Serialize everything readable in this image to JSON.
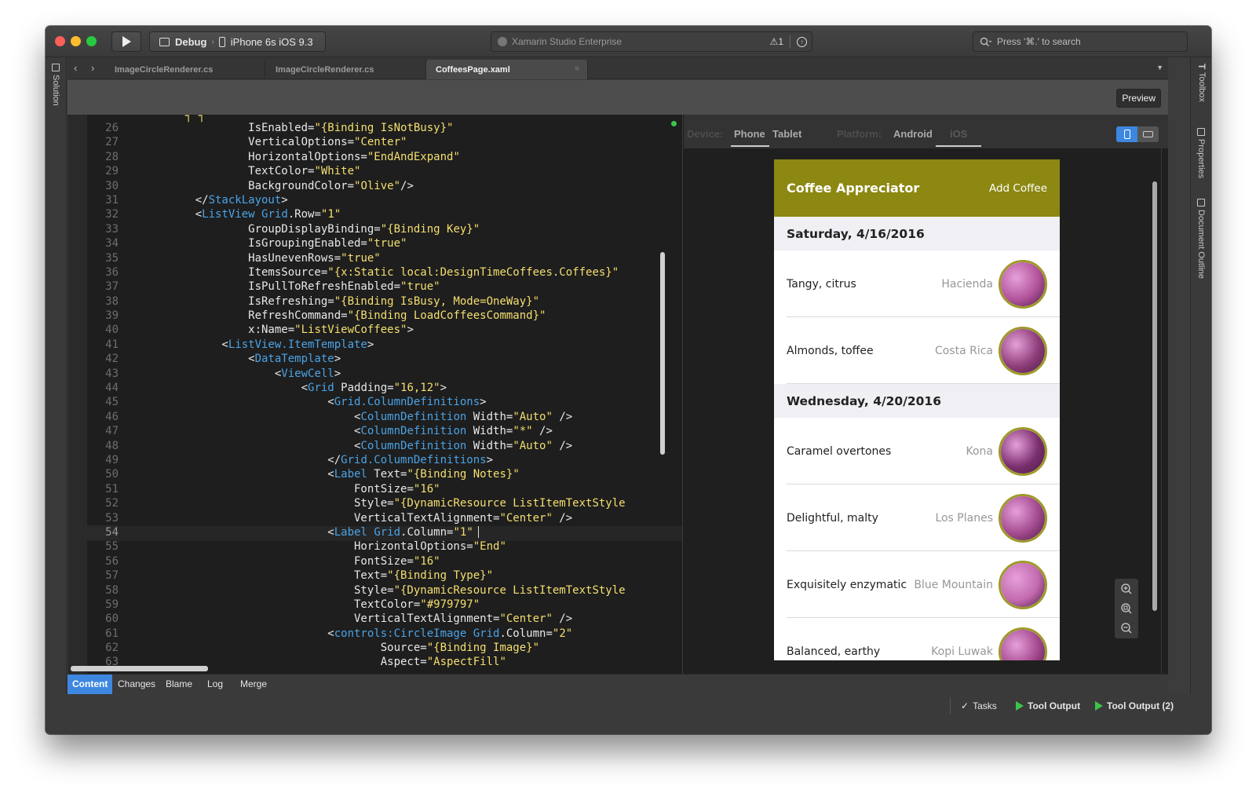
{
  "titlebar": {
    "config_label": "Debug",
    "device_label": "iPhone 6s iOS 9.3",
    "status_text": "Xamarin Studio Enterprise",
    "warning_count": "1",
    "search_placeholder": "Press '⌘.' to search"
  },
  "left_pad": {
    "solution_label": "Solution"
  },
  "right_pad": {
    "toolbox_label": "Toolbox",
    "properties_label": "Properties",
    "outline_label": "Document Outline"
  },
  "tabs": [
    {
      "label": "ImageCircleRenderer.cs"
    },
    {
      "label": "ImageCircleRenderer.cs"
    },
    {
      "label": "CoffeesPage.xaml"
    }
  ],
  "toolbar": {
    "preview_label": "Preview"
  },
  "editor": {
    "line_numbers": [
      "26",
      "27",
      "28",
      "29",
      "30",
      "31",
      "32",
      "33",
      "34",
      "35",
      "36",
      "37",
      "38",
      "39",
      "40",
      "41",
      "42",
      "43",
      "44",
      "45",
      "46",
      "47",
      "48",
      "49",
      "50",
      "51",
      "52",
      "53",
      "54",
      "55",
      "56",
      "57",
      "58",
      "59",
      "60",
      "61",
      "62",
      "63"
    ],
    "current_line": "54"
  },
  "preview": {
    "device_label": "Device:",
    "device_options": [
      "Phone",
      "Tablet"
    ],
    "platform_label": "Platform:",
    "platform_options": [
      "Android",
      "iOS"
    ],
    "app": {
      "title": "Coffee Appreciator",
      "action": "Add Coffee",
      "nav_color": "#8c8812",
      "thumb_border": "#9d9a2a",
      "groups": [
        {
          "date": "Saturday, 4/16/2016",
          "items": [
            {
              "notes": "Tangy, citrus",
              "type": "Hacienda",
              "tint": "#b2539b"
            },
            {
              "notes": "Almonds, toffee",
              "type": "Costa Rica",
              "tint": "#8e3d7a"
            }
          ]
        },
        {
          "date": "Wednesday, 4/20/2016",
          "items": [
            {
              "notes": "Caramel overtones",
              "type": "Kona",
              "tint": "#7a2f6e"
            },
            {
              "notes": "Delightful, malty",
              "type": "Los Planes",
              "tint": "#a24a8e"
            },
            {
              "notes": "Exquisitely enzymatic",
              "type": "Blue Mountain",
              "tint": "#c26aae"
            },
            {
              "notes": "Balanced, earthy",
              "type": "Kopi Luwak",
              "tint": "#a3488f"
            }
          ]
        }
      ]
    }
  },
  "bottom_tabs": [
    "Content",
    "Changes",
    "Blame",
    "Log",
    "Merge"
  ],
  "statusbar": {
    "tasks_label": "Tasks",
    "tool_output_label": "Tool Output",
    "tool_output2_label": "Tool Output (2)"
  },
  "colors": {
    "accent": "#3d87e0",
    "tag": "#4aa3e6",
    "string": "#f5df6f",
    "run_green": "#3bc64a"
  }
}
